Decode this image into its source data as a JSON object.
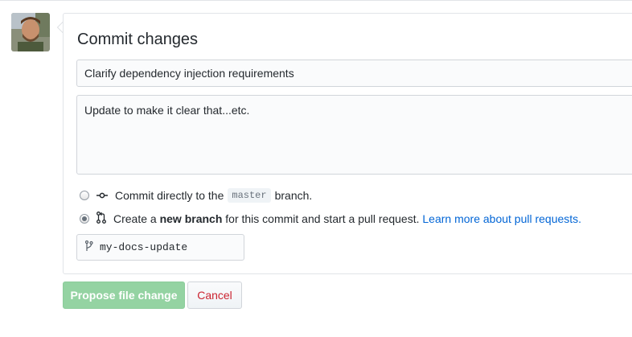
{
  "avatar": {
    "alt": "User avatar"
  },
  "commit": {
    "heading": "Commit changes",
    "summary_value": "Clarify dependency injection requirements",
    "description_value": "Update to make it clear that...etc."
  },
  "options": {
    "direct": {
      "prefix": "Commit directly to the",
      "branch": "master",
      "suffix": "branch.",
      "selected": false
    },
    "new_branch": {
      "prefix": "Create a",
      "bold": "new branch",
      "middle": "for this commit and start a pull request.",
      "link": "Learn more about pull requests.",
      "selected": true
    }
  },
  "branch_name": {
    "value": "my-docs-update"
  },
  "buttons": {
    "propose": "Propose file change",
    "cancel": "Cancel"
  },
  "icons": {
    "commit": "git-commit-icon",
    "pull_request": "git-pull-request-icon",
    "branch": "git-branch-icon"
  },
  "colors": {
    "link": "#0366d6",
    "propose_disabled": "#94d3a2",
    "cancel_text": "#cb2431"
  }
}
